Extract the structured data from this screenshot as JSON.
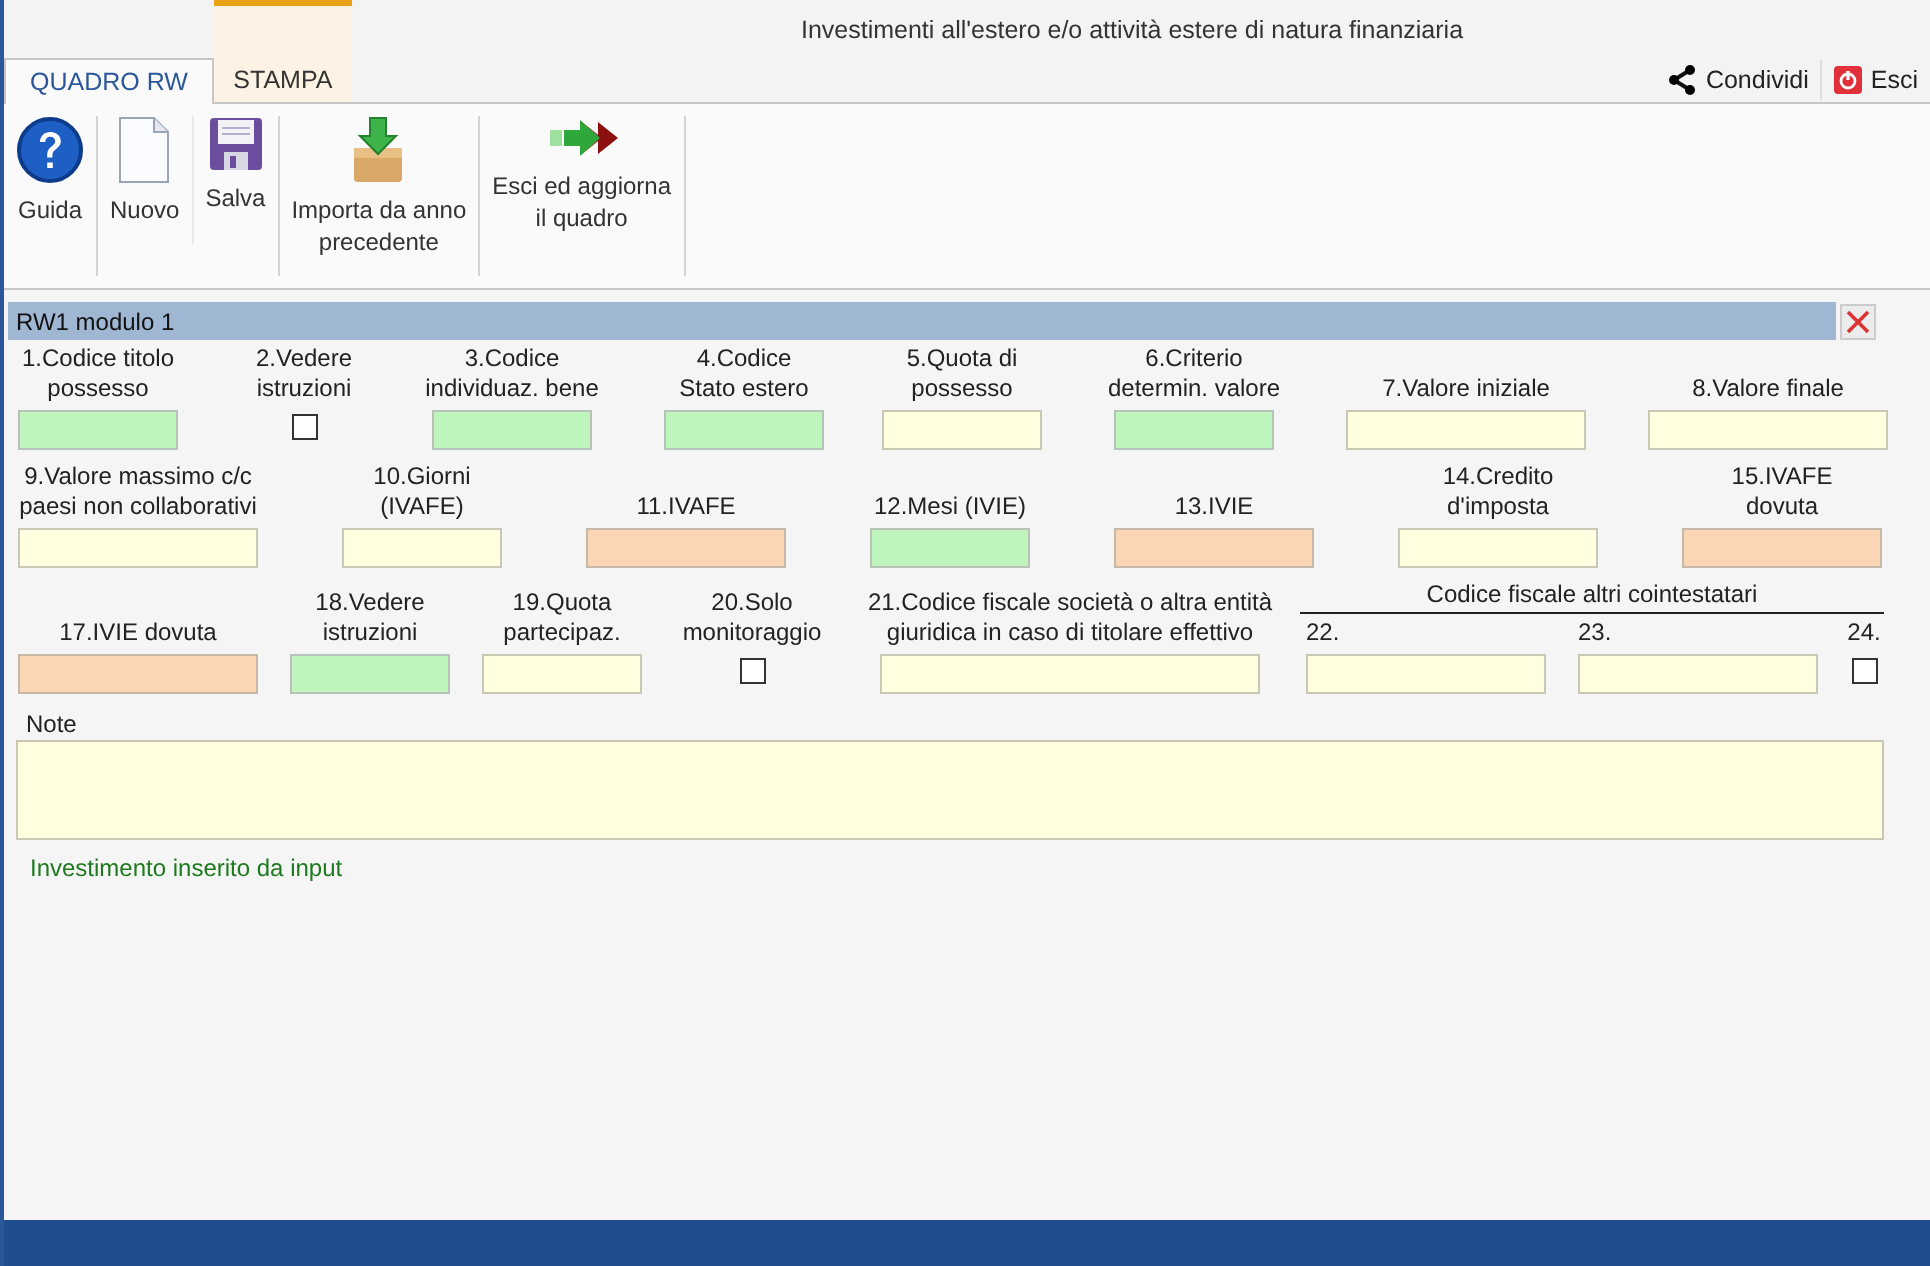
{
  "window": {
    "title": "Investimenti all'estero e/o attività estere di natura finanziaria"
  },
  "tabs": [
    {
      "label": "QUADRO RW",
      "selected": true,
      "accent": false
    },
    {
      "label": "STAMPA",
      "selected": false,
      "accent": true
    }
  ],
  "title_actions": [
    {
      "kind": "share",
      "label": "Condividi"
    },
    {
      "kind": "exit",
      "label": "Esci"
    }
  ],
  "ribbon": [
    {
      "kind": "help",
      "label": "Guida"
    },
    {
      "kind": "new",
      "label": "Nuovo"
    },
    {
      "kind": "save",
      "label": "Salva"
    },
    {
      "kind": "import",
      "label": "Importa da anno\nprecedente"
    },
    {
      "kind": "exit",
      "label": "Esci ed aggiorna\nil quadro"
    }
  ],
  "module": {
    "title": "RW1 modulo 1",
    "rows": [
      {
        "fields": [
          {
            "label": "1.Codice titolo\npossesso",
            "kind": "code"
          },
          {
            "label": "2.Vedere\nistruzioni",
            "kind": "checkbox",
            "checked": false
          },
          {
            "label": "3.Codice\nindividuaz. bene",
            "kind": "code"
          },
          {
            "label": "4.Codice\nStato estero",
            "kind": "code"
          },
          {
            "label": "5.Quota di\npossesso",
            "kind": "input"
          },
          {
            "label": "6.Criterio\ndetermin. valore",
            "kind": "code"
          },
          {
            "label": "7.Valore iniziale",
            "kind": "input"
          },
          {
            "label": "8.Valore finale",
            "kind": "input"
          }
        ]
      },
      {
        "fields": [
          {
            "label": "9.Valore massimo c/c\npaesi non collaborativi",
            "kind": "input"
          },
          {
            "label": "10.Giorni\n(IVAFE)",
            "kind": "input"
          },
          {
            "label": "11.IVAFE",
            "kind": "computed"
          },
          {
            "label": "12.Mesi (IVIE)",
            "kind": "code"
          },
          {
            "label": "13.IVIE",
            "kind": "computed"
          },
          {
            "label": "14.Credito\nd'imposta",
            "kind": "input"
          },
          {
            "label": "15.IVAFE\ndovuta",
            "kind": "computed"
          }
        ]
      },
      {
        "fields": [
          {
            "label": "17.IVIE dovuta",
            "kind": "computed"
          },
          {
            "label": "18.Vedere\nistruzioni",
            "kind": "code"
          },
          {
            "label": "19.Quota\npartecipaz.",
            "kind": "input"
          },
          {
            "label": "20.Solo\nmonitoraggio",
            "kind": "checkbox",
            "checked": false
          },
          {
            "label": "21.Codice fiscale società o altra entità\ngiuridica in caso di titolare effettivo",
            "kind": "input"
          }
        ],
        "group": {
          "title": "Codice fiscale altri cointestatari",
          "fields": [
            {
              "label": "22.",
              "kind": "input"
            },
            {
              "label": "23.",
              "kind": "input"
            },
            {
              "label": "24.",
              "kind": "checkbox",
              "checked": false
            }
          ]
        }
      }
    ],
    "note": {
      "label": "Note"
    },
    "status": "Investimento inserito da input"
  }
}
